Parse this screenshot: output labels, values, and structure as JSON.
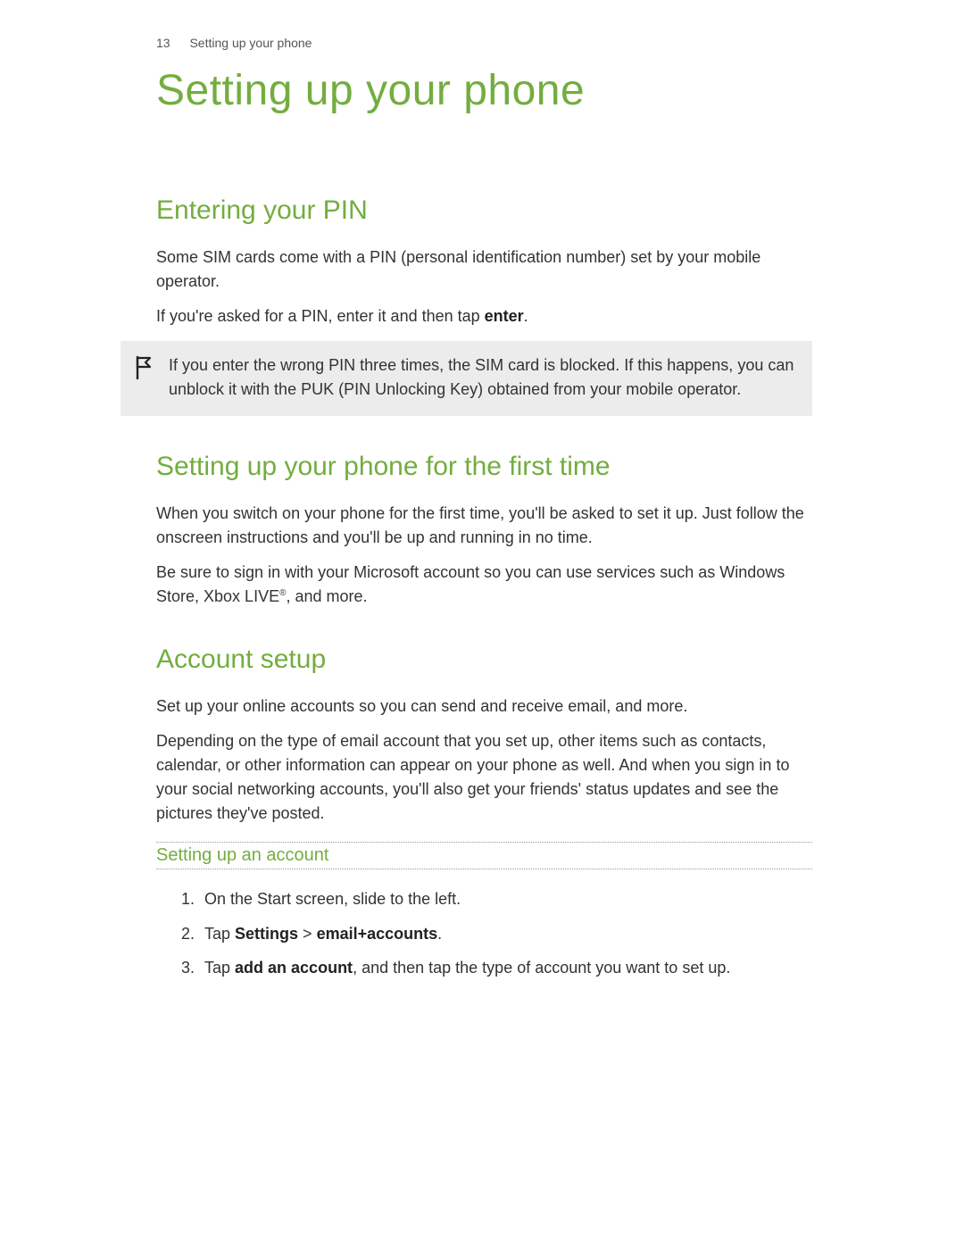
{
  "header": {
    "page_number": "13",
    "running_title": "Setting up your phone"
  },
  "title": "Setting up your phone",
  "sections": {
    "pin": {
      "heading": "Entering your PIN",
      "p1": "Some SIM cards come with a PIN (personal identification number) set by your mobile operator.",
      "p2_a": "If you're asked for a PIN, enter it and then tap ",
      "p2_bold": "enter",
      "p2_b": ".",
      "note": "If you enter the wrong PIN three times, the SIM card is blocked. If this happens, you can unblock it with the PUK (PIN Unlocking Key) obtained from your mobile operator."
    },
    "first_time": {
      "heading": "Setting up your phone for the first time",
      "p1": "When you switch on your phone for the first time, you'll be asked to set it up. Just follow the onscreen instructions and you'll be up and running in no time.",
      "p2_a": "Be sure to sign in with your Microsoft account so you can use services such as Windows Store, Xbox LIVE",
      "p2_sup": "®",
      "p2_b": ", and more."
    },
    "account": {
      "heading": "Account setup",
      "p1": "Set up your online accounts so you can send and receive email, and more.",
      "p2": "Depending on the type of email account that you set up, other items such as contacts, calendar, or other information can appear on your phone as well. And when you sign in to your social networking accounts, you'll also get your friends' status updates and see the pictures they've posted.",
      "sub_heading": "Setting up an account",
      "steps": {
        "s1": "On the Start screen, slide to the left.",
        "s2_a": "Tap ",
        "s2_bold1": "Settings",
        "s2_mid": " > ",
        "s2_bold2": "email+accounts",
        "s2_b": ".",
        "s3_a": "Tap ",
        "s3_bold": "add an account",
        "s3_b": ", and then tap the type of account you want to set up."
      }
    }
  }
}
